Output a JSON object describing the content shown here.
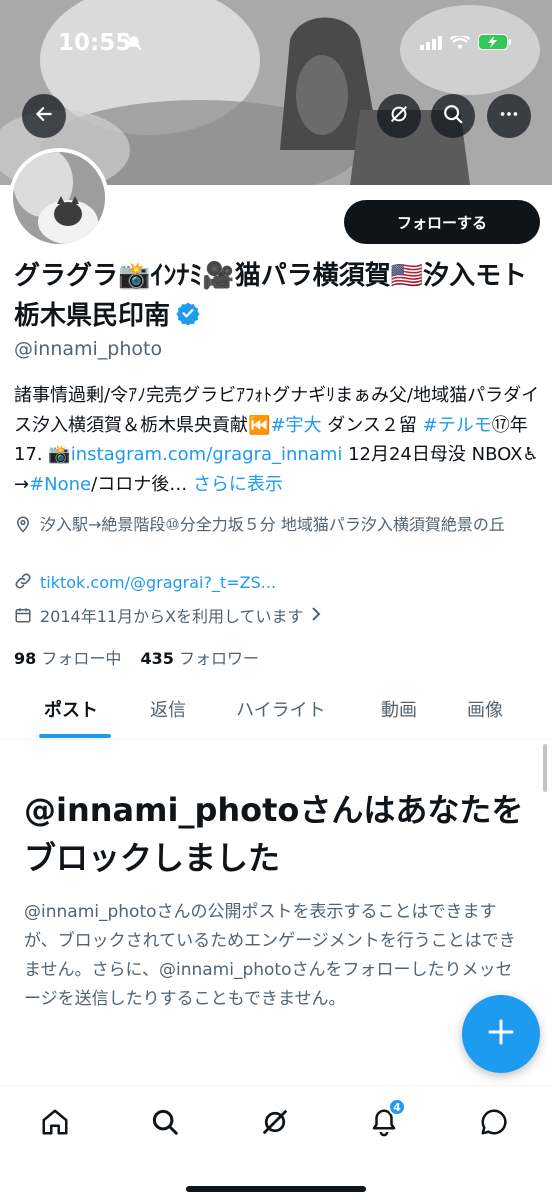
{
  "status_bar": {
    "time": "10:55",
    "battery_color": "#34c759"
  },
  "header": {
    "back_icon": "arrow-left-icon",
    "grok_icon": "grok-icon",
    "search_icon": "search-icon",
    "more_icon": "more-horizontal-icon"
  },
  "profile": {
    "follow_label": "フォローする",
    "display_name": "グラグラ📸ｲﾝﾅﾐ🎥猫パラ横須賀🇺🇸汐入モト栃木県民印南",
    "verified": true,
    "handle": "@innami_photo",
    "bio": {
      "part1": "諸事情過剰/令ｱﾉ完売グラビｱﾌｫﾄグナギﾘまぁみ父/地域猫パラダイス汐入横須賀＆栃木県央貢献⏮️",
      "hashtag1": "#宇大",
      "part2": " ダンス２留 ",
      "hashtag2": "#テルモ",
      "part3": "⑰年17. 📸",
      "link1": "instagram.com/gragra_innami",
      "part4": " 12月24日母没 NBOX♿→",
      "hashtag3": "#None",
      "part5": "/コロナ後… ",
      "more": "さらに表示"
    },
    "location": "汐入駅→絶景階段⑩分全力坂５分 地域猫パラ汐入横須賀絶景の丘",
    "website": "tiktok.com/@gragrai?_t=ZS...",
    "joined": "2014年11月からXを利用しています",
    "following_count": "98",
    "following_label": "フォロー中",
    "followers_count": "435",
    "followers_label": "フォロワー"
  },
  "tabs": [
    {
      "label": "ポスト",
      "active": true
    },
    {
      "label": "返信",
      "active": false
    },
    {
      "label": "ハイライト",
      "active": false
    },
    {
      "label": "動画",
      "active": false
    },
    {
      "label": "画像",
      "active": false
    }
  ],
  "blocked": {
    "title": "@innami_photoさんはあなたをブロックしました",
    "body": "@innami_photoさんの公開ポストを表示することはできますが、ブロックされているためエンゲージメントを行うことはできません。さらに、@innami_photoさんをフォローしたりメッセージを送信したりすることもできません。"
  },
  "bottom_nav": {
    "items": [
      "home-icon",
      "search-icon",
      "grok-icon",
      "notifications-icon",
      "messages-icon"
    ],
    "notification_badge": "4"
  },
  "colors": {
    "accent": "#1d9bf0",
    "text": "#0f1419",
    "secondary": "#536471"
  }
}
